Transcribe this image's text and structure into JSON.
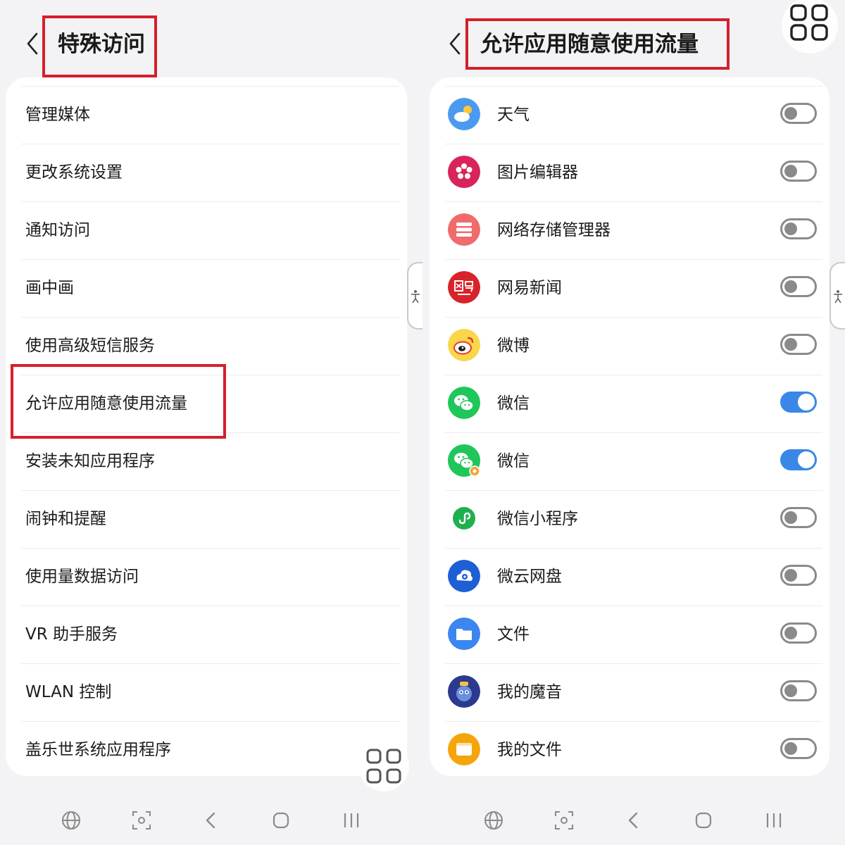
{
  "left": {
    "title": "特殊访问",
    "back_icon": "chevron-left-icon",
    "items": [
      {
        "label": "管理媒体"
      },
      {
        "label": "更改系统设置"
      },
      {
        "label": "通知访问"
      },
      {
        "label": "画中画"
      },
      {
        "label": "使用高级短信服务"
      },
      {
        "label": "允许应用随意使用流量"
      },
      {
        "label": "安装未知应用程序"
      },
      {
        "label": "闹钟和提醒"
      },
      {
        "label": "使用量数据访问"
      },
      {
        "label": "VR 助手服务"
      },
      {
        "label": "WLAN 控制"
      },
      {
        "label": "盖乐世系统应用程序"
      }
    ]
  },
  "right": {
    "title": "允许应用随意使用流量",
    "back_icon": "chevron-left-icon",
    "apps": [
      {
        "name": "天气",
        "icon": "weather-app-icon",
        "enabled": false
      },
      {
        "name": "图片编辑器",
        "icon": "photo-editor-app-icon",
        "enabled": false
      },
      {
        "name": "网络存储管理器",
        "icon": "network-storage-app-icon",
        "enabled": false
      },
      {
        "name": "网易新闻",
        "icon": "netease-news-app-icon",
        "enabled": false
      },
      {
        "name": "微博",
        "icon": "weibo-app-icon",
        "enabled": false
      },
      {
        "name": "微信",
        "icon": "wechat-app-icon",
        "enabled": true
      },
      {
        "name": "微信",
        "icon": "wechat-dual-app-icon",
        "enabled": true
      },
      {
        "name": "微信小程序",
        "icon": "wechat-miniprogram-app-icon",
        "enabled": false
      },
      {
        "name": "微云网盘",
        "icon": "weiyun-app-icon",
        "enabled": false
      },
      {
        "name": "文件",
        "icon": "files-app-icon",
        "enabled": false
      },
      {
        "name": "我的魔音",
        "icon": "my-magic-voice-app-icon",
        "enabled": false
      },
      {
        "name": "我的文件",
        "icon": "my-files-app-icon",
        "enabled": false
      }
    ]
  },
  "nav_icons": [
    "globe-icon",
    "screenshot-scan-icon",
    "back-icon",
    "home-icon",
    "recents-icon"
  ],
  "floating_button_icon": "grid-apps-icon",
  "side_handle_icon": "accessibility-person-icon",
  "colors": {
    "highlight_box": "#d5202b",
    "toggle_on": "#3a87e8",
    "toggle_off": "#8a8a8a",
    "background": "#f3f3f5",
    "card": "#ffffff"
  }
}
